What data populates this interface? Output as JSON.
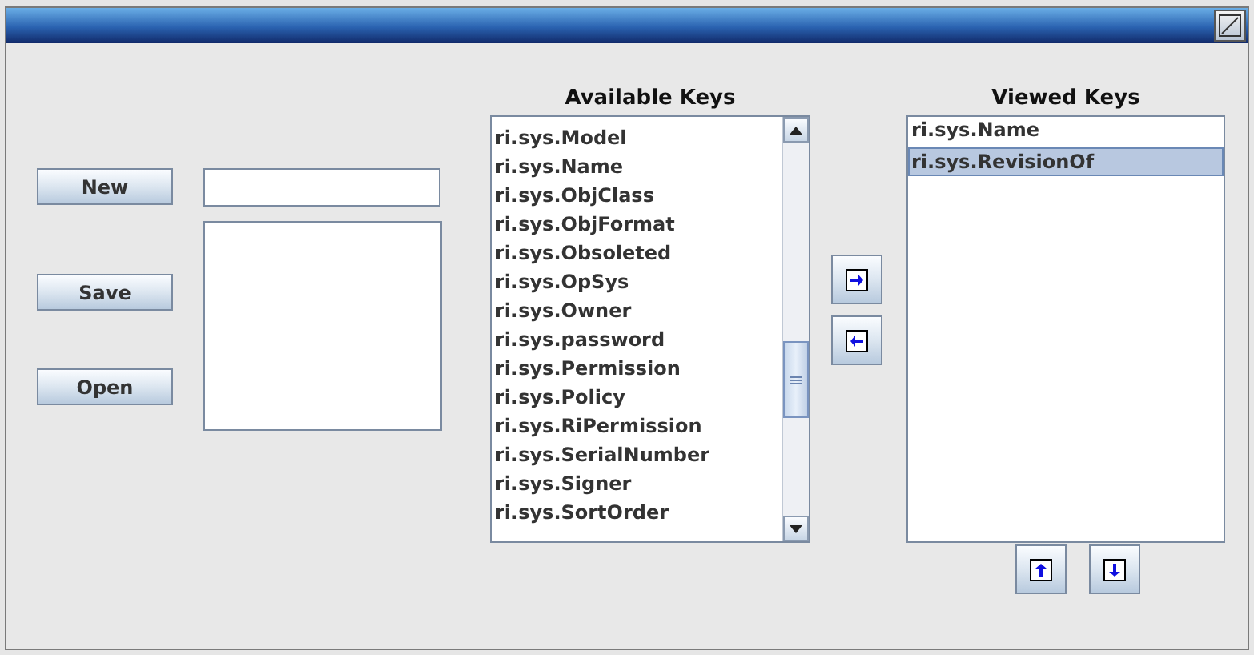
{
  "actions": {
    "buttons": [
      {
        "label": "New"
      },
      {
        "label": "Save"
      },
      {
        "label": "Open"
      }
    ]
  },
  "available_keys": {
    "heading": "Available Keys",
    "items": [
      {
        "label": "ri.sys.Model",
        "selected": false
      },
      {
        "label": "ri.sys.Name",
        "selected": false
      },
      {
        "label": "ri.sys.ObjClass",
        "selected": false
      },
      {
        "label": "ri.sys.ObjFormat",
        "selected": false
      },
      {
        "label": "ri.sys.Obsoleted",
        "selected": false
      },
      {
        "label": "ri.sys.OpSys",
        "selected": false
      },
      {
        "label": "ri.sys.Owner",
        "selected": false
      },
      {
        "label": "ri.sys.password",
        "selected": false
      },
      {
        "label": "ri.sys.Permission",
        "selected": false
      },
      {
        "label": "ri.sys.Policy",
        "selected": false
      },
      {
        "label": "ri.sys.RiPermission",
        "selected": false
      },
      {
        "label": "ri.sys.SerialNumber",
        "selected": false
      },
      {
        "label": "ri.sys.Signer",
        "selected": false
      },
      {
        "label": "ri.sys.SortOrder",
        "selected": false
      }
    ]
  },
  "viewed_keys": {
    "heading": "Viewed Keys",
    "items": [
      {
        "label": "ri.sys.Name",
        "selected": false
      },
      {
        "label": "ri.sys.RevisionOf",
        "selected": true
      }
    ]
  }
}
